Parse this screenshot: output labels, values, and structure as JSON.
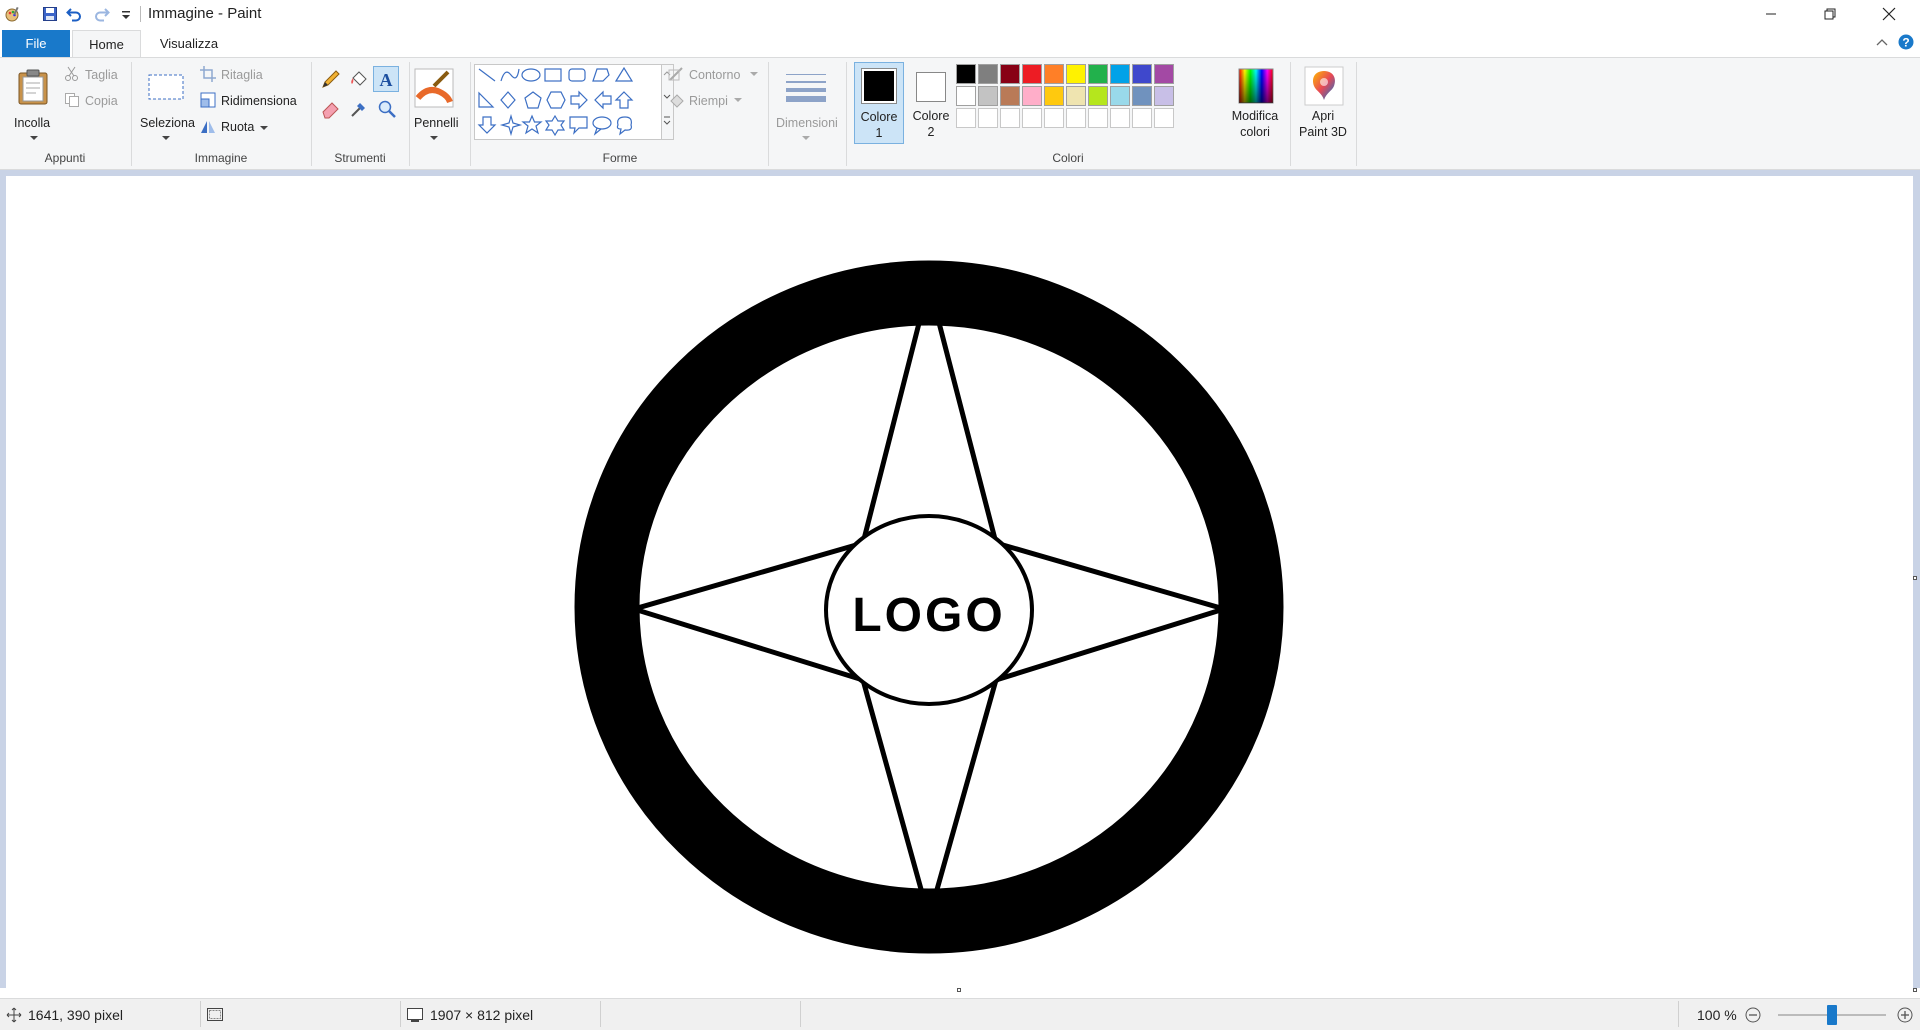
{
  "window": {
    "title": "Immagine - Paint"
  },
  "tabs": {
    "file": "File",
    "home": "Home",
    "view": "Visualizza"
  },
  "ribbon": {
    "clipboard": {
      "paste": "Incolla",
      "cut": "Taglia",
      "copy": "Copia",
      "group": "Appunti"
    },
    "image": {
      "select": "Seleziona",
      "crop": "Ritaglia",
      "resize": "Ridimensiona",
      "rotate": "Ruota",
      "group": "Immagine"
    },
    "tools": {
      "group": "Strumenti"
    },
    "brushes": {
      "label": "Pennelli"
    },
    "shapes": {
      "outline": "Contorno",
      "fill": "Riempi",
      "group": "Forme"
    },
    "size": {
      "label": "Dimensioni"
    },
    "colors": {
      "color1_line1": "Colore",
      "color1_line2": "1",
      "color2_line1": "Colore",
      "color2_line2": "2",
      "edit_line1": "Modifica",
      "edit_line2": "colori",
      "group": "Colori",
      "color1_value": "#000000",
      "color2_value": "#ffffff",
      "palette_row1": [
        "#000000",
        "#7f7f7f",
        "#880015",
        "#ed1c24",
        "#ff7f27",
        "#fff200",
        "#22b14c",
        "#00a2e8",
        "#3f48cc",
        "#a349a4"
      ],
      "palette_row2": [
        "#ffffff",
        "#c3c3c3",
        "#b97a57",
        "#ffaec9",
        "#ffc90e",
        "#efe4b0",
        "#b5e61d",
        "#99d9ea",
        "#7092be",
        "#c8bfe7"
      ]
    },
    "paint3d": {
      "line1": "Apri",
      "line2": "Paint 3D"
    }
  },
  "canvas": {
    "logo_text": "LOGO"
  },
  "status": {
    "cursor_pos": "1641, 390 pixel",
    "image_size": "1907 × 812 pixel",
    "zoom": "100 %",
    "zoom_percent": 100
  }
}
